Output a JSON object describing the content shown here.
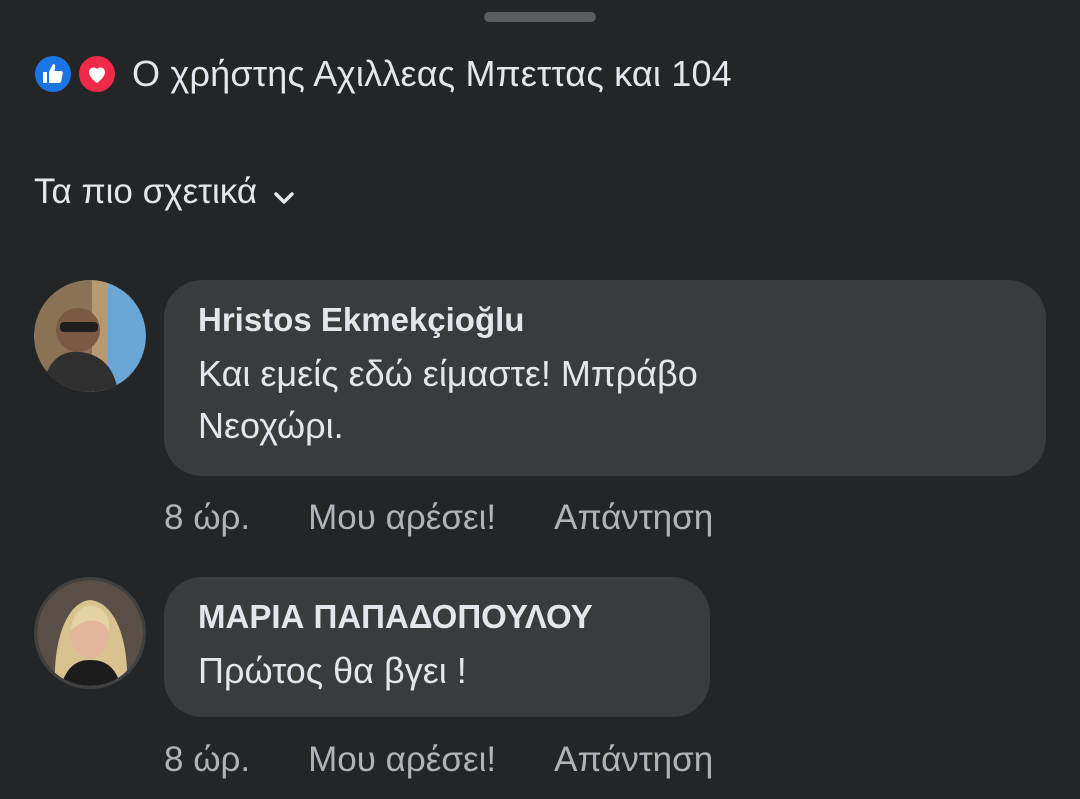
{
  "reactions": {
    "summary": "Ο χρήστης Αχιλλεας Μπεττας και 104",
    "icons": [
      "like-icon",
      "love-icon"
    ],
    "colors": {
      "like": "#1b74e4",
      "love": "#f02849"
    }
  },
  "sort": {
    "label": "Τα πιο σχετικά"
  },
  "comments": [
    {
      "author": "Hristos Ekmekçioğlu",
      "text_line1": "Και εμείς εδώ είμαστε! Μπράβο",
      "text_line2": "Νεοχώρι.",
      "time": "8 ώρ.",
      "like_label": "Μου αρέσει!",
      "reply_label": "Απάντηση"
    },
    {
      "author": "ΜΑΡΙΑ ΠΑΠΑΔΟΠΟΥΛΟΥ",
      "text_line1": "Πρώτος θα βγει !",
      "time": "8 ώρ.",
      "like_label": "Μου αρέσει!",
      "reply_label": "Απάντηση"
    }
  ],
  "theme": {
    "background": "#242526",
    "bubble": "#3a3b3c",
    "text": "#e4e6eb",
    "muted": "#b0b3b8"
  }
}
